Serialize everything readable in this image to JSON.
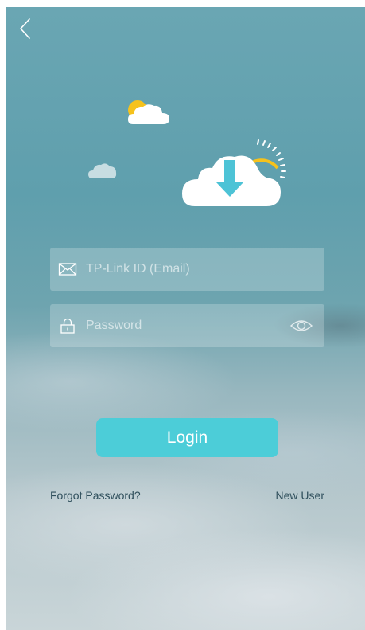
{
  "header": {
    "back_icon": "chevron-left-icon"
  },
  "illustration": {
    "icons": [
      "sun-cloud-icon",
      "small-cloud-icon",
      "cloud-download-icon"
    ],
    "colors": {
      "sun": "#f6c21c",
      "cloud": "#ffffff",
      "arrow": "#4dc3d6"
    }
  },
  "form": {
    "email": {
      "placeholder": "TP-Link ID (Email)",
      "value": "",
      "icon": "envelope-icon"
    },
    "password": {
      "placeholder": "Password",
      "value": "",
      "icon": "lock-icon",
      "toggle_icon": "eye-icon"
    },
    "login_label": "Login"
  },
  "links": {
    "forgot_password": "Forgot Password?",
    "new_user": "New User"
  },
  "colors": {
    "accent": "#4ccdd8",
    "link_text": "#2f4f5c"
  }
}
